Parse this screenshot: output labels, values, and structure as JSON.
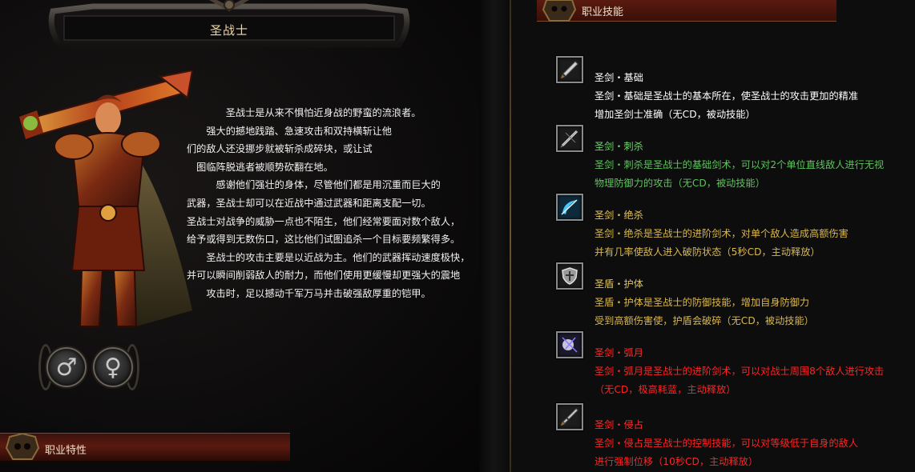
{
  "class_name": "圣战士",
  "description": [
    "　　　　圣战士是从来不惧怕近身战的野蛮的流浪者。",
    "　　强大的撼地践踏、急速攻击和双持横斩让他",
    "们的敌人还没挪步就被斩杀成碎块，或让试",
    "　图临阵脱逃者被顺势砍翻在地。",
    "　　　感谢他们强壮的身体，尽管他们都是用沉重而巨大的",
    "武器，圣战士却可以在近战中通过武器和距离支配一切。",
    "圣战士对战争的威胁一点也不陌生，他们经常要面对数个敌人，",
    "给予或得到无数伤口，这比他们试图追杀一个目标要频繁得多。",
    "　　圣战士的攻击主要是以近战为主。他们的武器挥动速度极快，",
    "并可以瞬间削弱敌人的耐力，而他们使用更缓慢却更强大的震地",
    "　　攻击时，足以撼动千军万马并击破强敌厚重的铠甲。"
  ],
  "gender": {
    "male_symbol": "♂",
    "female_symbol": "♀"
  },
  "sections": {
    "traits": "职业特性",
    "skills": "职业技能"
  },
  "skills": [
    {
      "name": "圣剑・基础",
      "lines": [
        "圣剑・基础是圣战士的基本所在，使圣战士的攻击更加的精准",
        "增加圣剑士准确（无CD，被动技能）"
      ],
      "name_color": "#ffffff",
      "text_color": "#ffffff",
      "icon": "sword-icon"
    },
    {
      "name": "圣剑・刺杀",
      "lines": [
        "圣剑・刺杀是圣战士的基础剑术，可以对2个单位直线敌人进行无视",
        "物理防御力的攻击（无CD，被动技能）"
      ],
      "name_color": "#6fd36f",
      "text_color": "#5cc45c",
      "icon": "thrust-icon"
    },
    {
      "name": "圣剑・绝杀",
      "lines": [
        "圣剑・绝杀是圣战士的进阶剑术，对单个敌人造成高额伤害",
        "并有几率使敌人进入破防状态（5秒CD，主动释放）"
      ],
      "name_color": "#e3c35a",
      "text_color": "#d9b84e",
      "icon": "slash-icon"
    },
    {
      "name": "圣盾・护体",
      "lines": [
        "圣盾・护体是圣战士的防御技能，增加自身防御力",
        "受到高额伤害使，护盾会破碎（无CD，被动技能）"
      ],
      "name_color": "#e3c35a",
      "text_color": "#d9b84e",
      "icon": "shield-icon"
    },
    {
      "name": "圣剑・弧月",
      "lines": [
        "圣剑・弧月是圣战士的进阶剑术，可以对战士周围8个敌人进行攻击",
        "（无CD，极高耗蓝，主动释放）"
      ],
      "name_color": "#ff2a2a",
      "text_color": "#ff2424",
      "icon": "arc-moon-icon"
    },
    {
      "name": "圣剑・侵占",
      "lines": [
        "圣剑・侵占是圣战士的控制技能，可以对等级低于自身的敌人",
        "进行强制位移（10秒CD，主动释放）"
      ],
      "name_color": "#ff2a2a",
      "text_color": "#ff2424",
      "icon": "blade-icon"
    }
  ]
}
